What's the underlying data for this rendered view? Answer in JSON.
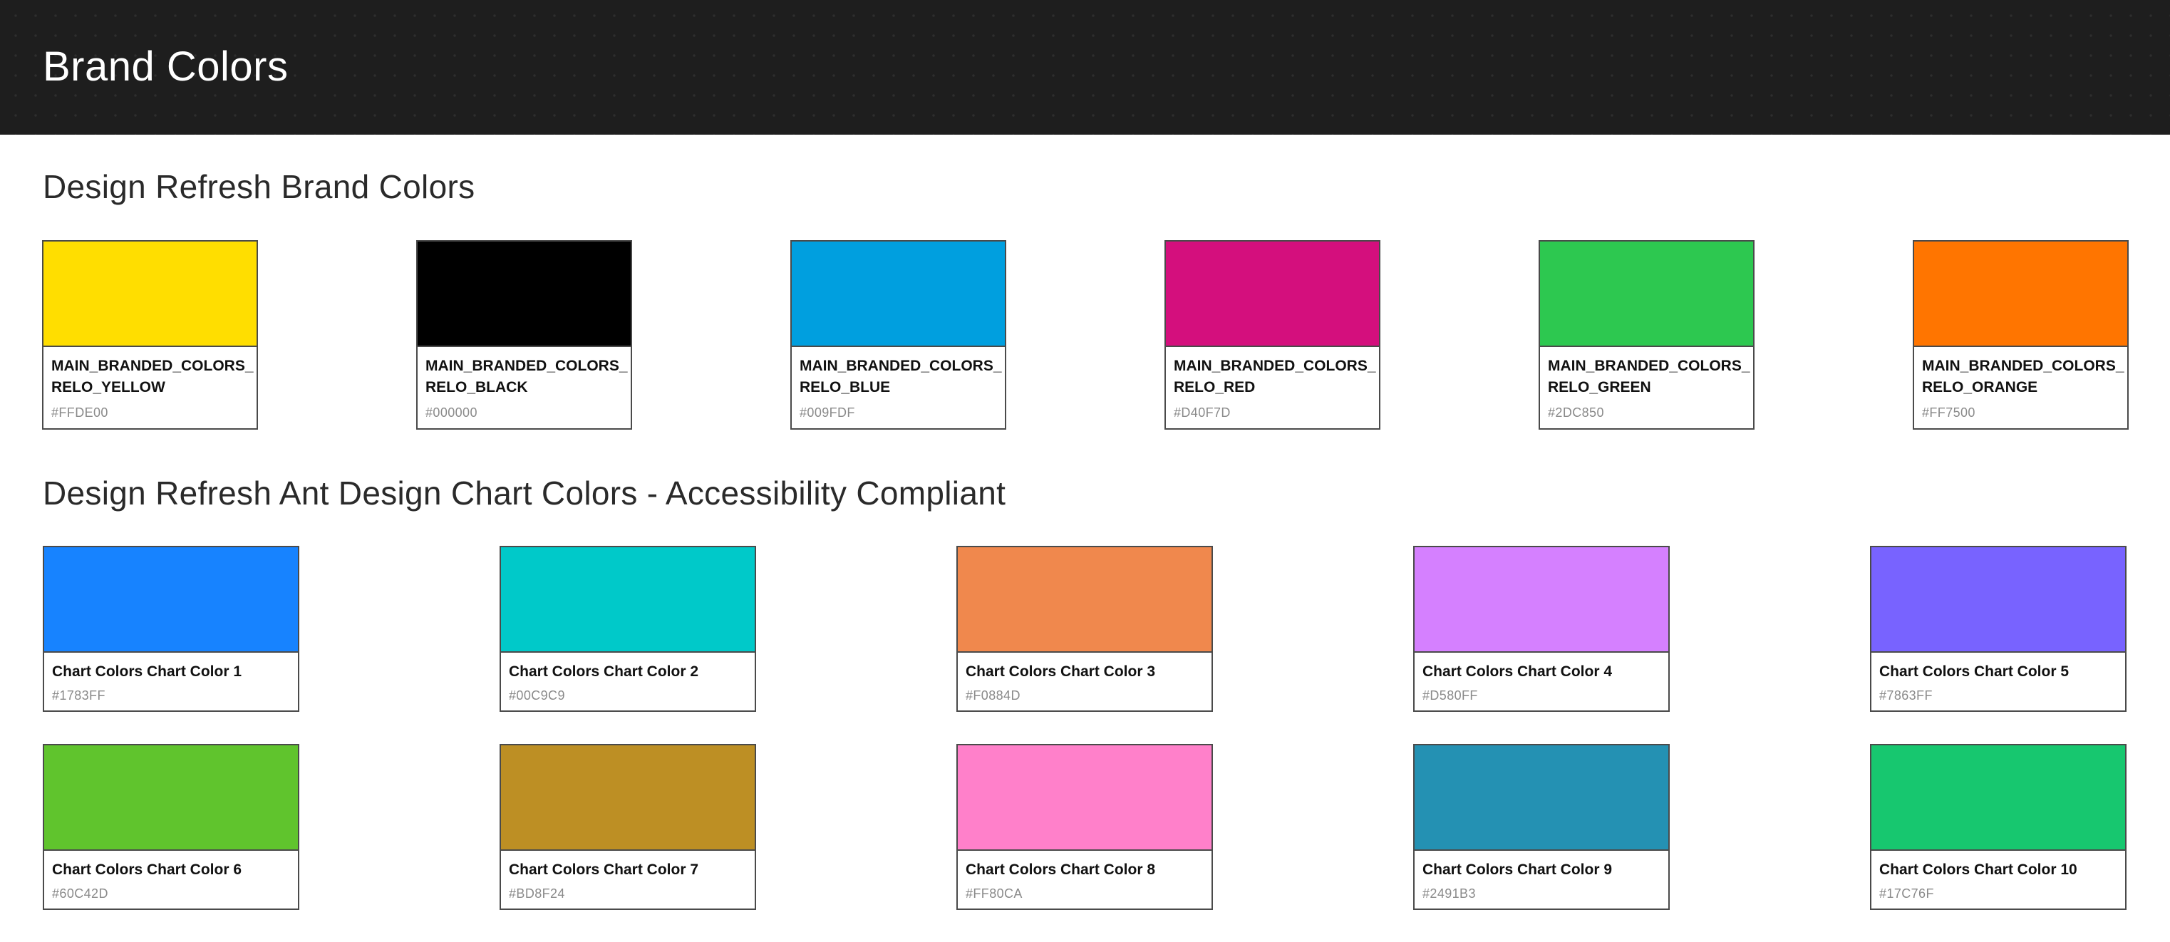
{
  "header": {
    "title": "Brand Colors"
  },
  "brand_section": {
    "title": "Design Refresh Brand Colors",
    "colors": [
      {
        "name": "MAIN_BRANDED_COLORS_\nRELO_YELLOW",
        "hex": "#FFDE00"
      },
      {
        "name": "MAIN_BRANDED_COLORS_\nRELO_BLACK",
        "hex": "#000000"
      },
      {
        "name": "MAIN_BRANDED_COLORS_\nRELO_BLUE",
        "hex": "#009FDF"
      },
      {
        "name": "MAIN_BRANDED_COLORS_\nRELO_RED",
        "hex": "#D40F7D"
      },
      {
        "name": "MAIN_BRANDED_COLORS_\nRELO_GREEN",
        "hex": "#2DC850"
      },
      {
        "name": "MAIN_BRANDED_COLORS_\nRELO_ORANGE",
        "hex": "#FF7500"
      }
    ]
  },
  "chart_section": {
    "title": "Design Refresh Ant Design Chart Colors - Accessibility Compliant",
    "colors": [
      {
        "name": "Chart Colors Chart Color 1",
        "hex": "#1783FF"
      },
      {
        "name": "Chart Colors Chart Color 2",
        "hex": "#00C9C9"
      },
      {
        "name": "Chart Colors Chart Color 3",
        "hex": "#F0884D"
      },
      {
        "name": "Chart Colors Chart Color 4",
        "hex": "#D580FF"
      },
      {
        "name": "Chart Colors Chart Color 5",
        "hex": "#7863FF"
      },
      {
        "name": "Chart Colors Chart Color 6",
        "hex": "#60C42D"
      },
      {
        "name": "Chart Colors Chart Color 7",
        "hex": "#BD8F24"
      },
      {
        "name": "Chart Colors Chart Color 8",
        "hex": "#FF80CA"
      },
      {
        "name": "Chart Colors Chart Color 9",
        "hex": "#2491B3"
      },
      {
        "name": "Chart Colors Chart Color 10",
        "hex": "#17C76F"
      }
    ]
  }
}
